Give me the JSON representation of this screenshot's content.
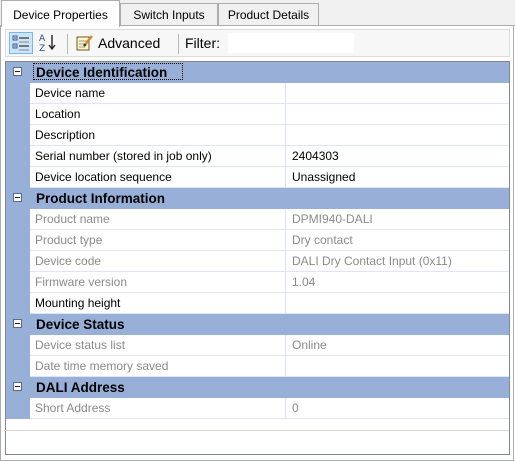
{
  "tabs": [
    {
      "label": "Device Properties",
      "active": true
    },
    {
      "label": "Switch Inputs",
      "active": false
    },
    {
      "label": "Product Details",
      "active": false
    }
  ],
  "toolbar": {
    "categorized_icon": "categorized-view-icon",
    "alphabetical_icon": "sort-az-icon",
    "advanced_icon": "notepad-edit-icon",
    "advanced_label": "Advanced",
    "filter_label": "Filter:",
    "filter_value": ""
  },
  "grid": {
    "categories": [
      {
        "label": "Device Identification",
        "rows": [
          {
            "name": "Device name",
            "value": "",
            "readonly": false
          },
          {
            "name": "Location",
            "value": "",
            "readonly": false
          },
          {
            "name": "Description",
            "value": "",
            "readonly": false
          },
          {
            "name": "Serial number (stored in job only)",
            "value": "2404303",
            "readonly": false
          },
          {
            "name": "Device location sequence",
            "value": "Unassigned",
            "readonly": false
          }
        ]
      },
      {
        "label": "Product Information",
        "rows": [
          {
            "name": "Product name",
            "value": "DPMI940-DALI",
            "readonly": true
          },
          {
            "name": "Product type",
            "value": "Dry contact",
            "readonly": true
          },
          {
            "name": "Device code",
            "value": "DALI Dry Contact Input (0x11)",
            "readonly": true
          },
          {
            "name": "Firmware version",
            "value": "1.04",
            "readonly": true
          },
          {
            "name": "Mounting height",
            "value": "",
            "readonly": false
          }
        ]
      },
      {
        "label": "Device Status",
        "rows": [
          {
            "name": "Device status list",
            "value": "Online",
            "readonly": true
          },
          {
            "name": "Date time memory saved",
            "value": "",
            "readonly": true
          }
        ]
      },
      {
        "label": "DALI Address",
        "rows": [
          {
            "name": "Short Address",
            "value": "0",
            "readonly": true
          }
        ]
      }
    ]
  },
  "colors": {
    "category_band": "#98b0d8",
    "grid_line": "#dce6f5",
    "readonly_text": "#8a8a8a"
  }
}
